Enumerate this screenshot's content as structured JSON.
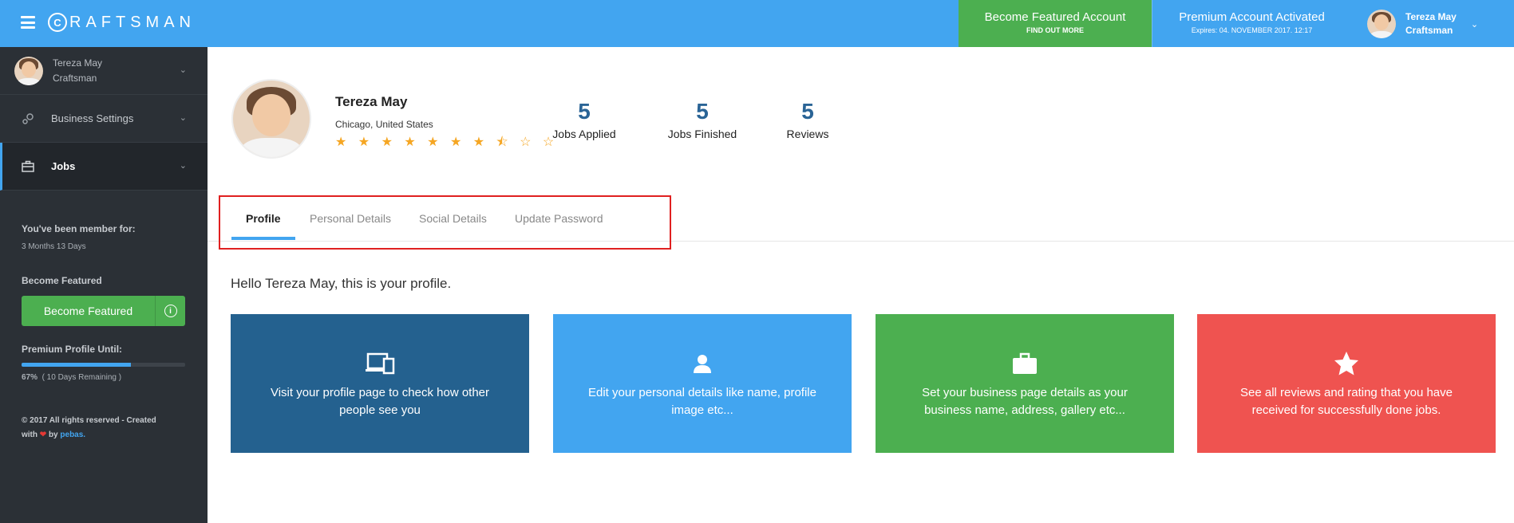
{
  "header": {
    "logo_mark": "C",
    "logo_text": "RAFTSMAN",
    "featured": {
      "title": "Become Featured Account",
      "subtitle": "FIND OUT MORE"
    },
    "premium": {
      "title": "Premium Account Activated",
      "subtitle": "Expires: 04. NOVEMBER 2017. 12:17"
    },
    "user": {
      "name": "Tereza May",
      "role": "Craftsman"
    }
  },
  "sidebar": {
    "user": {
      "name": "Tereza May",
      "role": "Craftsman"
    },
    "items": [
      {
        "label": "Business Settings",
        "icon": "gears-icon"
      },
      {
        "label": "Jobs",
        "icon": "briefcase-icon"
      }
    ],
    "member_heading": "You've been member for:",
    "member_duration": "3 Months 13 Days",
    "featured_heading": "Become Featured",
    "featured_button": "Become Featured",
    "premium_heading": "Premium Profile Until:",
    "premium_percent": "67%",
    "premium_remaining": "( 10 Days Remaining )",
    "premium_progress": 0.67,
    "footer_line1": "© 2017 All rights reserved - Created",
    "footer_with": "with",
    "footer_by": "by",
    "footer_link": "pebas."
  },
  "profile": {
    "name": "Tereza May",
    "location": "Chicago, United States",
    "rating": "★ ★ ★ ★ ★ ★ ★ ⯪ ☆ ☆",
    "stats": [
      {
        "value": "5",
        "label": "Jobs Applied"
      },
      {
        "value": "5",
        "label": "Jobs Finished"
      },
      {
        "value": "5",
        "label": "Reviews"
      }
    ]
  },
  "tabs": [
    "Profile",
    "Personal Details",
    "Social Details",
    "Update Password"
  ],
  "greeting": "Hello Tereza May, this is your profile.",
  "cards": [
    {
      "text": "Visit your profile page to check how other people see you",
      "icon": "devices-icon",
      "color": "#24618f"
    },
    {
      "text": "Edit your personal details like name, profile image etc...",
      "icon": "user-icon",
      "color": "#42a5f0"
    },
    {
      "text": "Set your business page details as your business name, address, gallery etc...",
      "icon": "briefcase-icon",
      "color": "#4caf50"
    },
    {
      "text": "See all reviews and rating that you have received for successfully done jobs.",
      "icon": "star-icon",
      "color": "#ef5350"
    }
  ]
}
